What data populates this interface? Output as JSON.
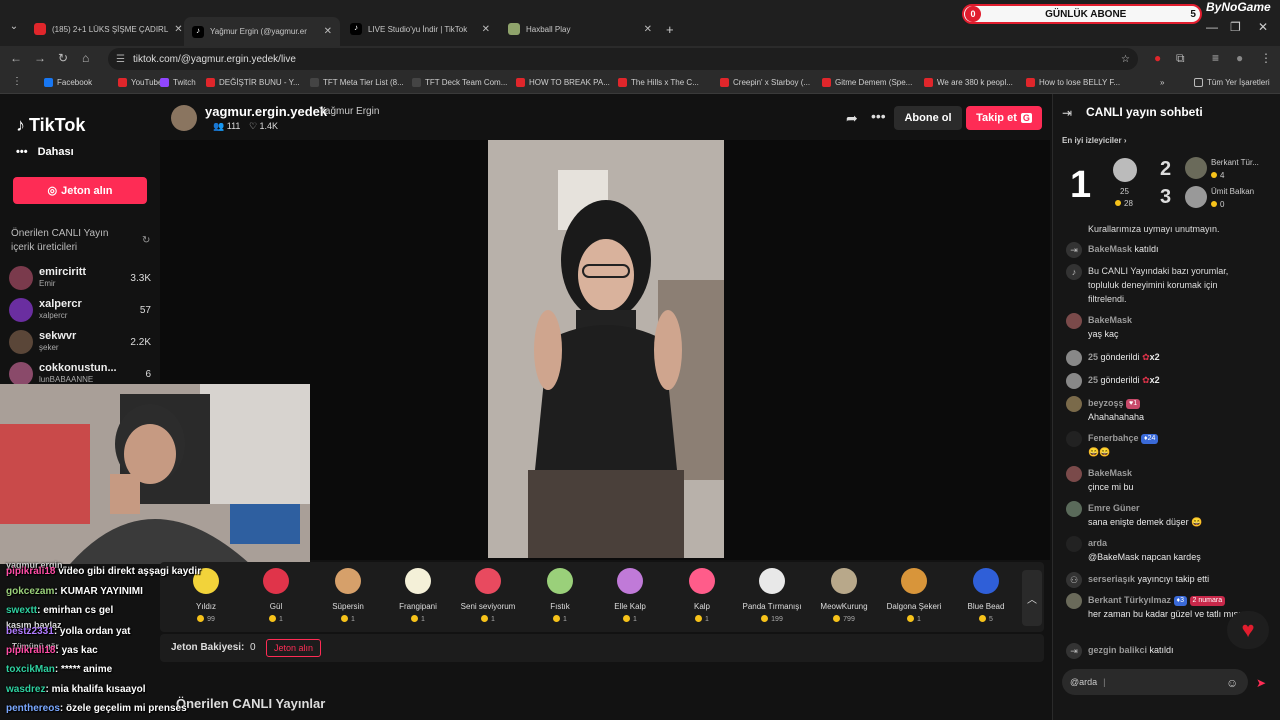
{
  "browser": {
    "tabs": [
      {
        "title": "(185) 2+1 LÜKS ŞİŞME ÇADIRL",
        "color": "#e0262b"
      },
      {
        "title": "Yağmur Ergin (@yagmur.er",
        "color": "#ffffff"
      },
      {
        "title": "LIVE Studio'yu İndir | TikTok",
        "color": "#ffffff"
      },
      {
        "title": "Haxball Play",
        "color": "#8fa36b"
      }
    ],
    "url": "tiktok.com/@yagmur.ergin.yedek/live",
    "bookmarks": [
      {
        "label": "Facebook",
        "color": "#1877f2"
      },
      {
        "label": "YouTube",
        "color": "#e0262b"
      },
      {
        "label": "Twitch",
        "color": "#9146ff"
      },
      {
        "label": "DEĞİŞTİR BUNU - Y...",
        "color": "#e0262b"
      },
      {
        "label": "TFT Meta Tier List (8...",
        "color": "#444444"
      },
      {
        "label": "TFT Deck Team Com...",
        "color": "#444444"
      },
      {
        "label": "HOW TO BREAK PA...",
        "color": "#e0262b"
      },
      {
        "label": "The Hills x The C...",
        "color": "#e0262b"
      },
      {
        "label": "Creepin' x Starboy (...",
        "color": "#e0262b"
      },
      {
        "label": "Gitme Demem (Spe...",
        "color": "#e0262b"
      },
      {
        "label": "We are 380 k peopl...",
        "color": "#e0262b"
      },
      {
        "label": "How to lose BELLY F...",
        "color": "#e0262b"
      }
    ],
    "all_bookmarks": "Tüm Yer İşaretleri"
  },
  "overlay": {
    "left": "0",
    "label": "GÜNLÜK ABONE",
    "right": "5",
    "brand": "ByNoGame"
  },
  "sidebar": {
    "logo": "TikTok",
    "more": "Dahası",
    "coin_button": "Jeton alın",
    "suggested_header": "Önerilen CANLI Yayın içerik üreticileri",
    "creators": [
      {
        "name": "emirciritt",
        "sub": "Emir",
        "count": "3.3K"
      },
      {
        "name": "xalpercr",
        "sub": "xalpercr",
        "count": "57"
      },
      {
        "name": "sekwvr",
        "sub": "şeker",
        "count": "2.2K"
      },
      {
        "name": "cokkonustun...",
        "sub": "lunBABAANNE",
        "count": "6"
      }
    ]
  },
  "stream": {
    "username": "yagmur.ergin.yedek",
    "display_name": "Yağmur Ergin",
    "viewers": "111",
    "likes": "1.4K",
    "subscribe": "Abone ol",
    "follow": "Takip et",
    "follow_badge": "G"
  },
  "gifts": [
    {
      "name": "Yıldız",
      "price": "99",
      "color": "#f2d33a"
    },
    {
      "name": "Gül",
      "price": "1",
      "color": "#e0344a"
    },
    {
      "name": "Süpersin",
      "price": "1",
      "color": "#d6a06a"
    },
    {
      "name": "Frangipani",
      "price": "1",
      "color": "#f4f0d8"
    },
    {
      "name": "Seni seviyorum",
      "price": "1",
      "color": "#e84a5f"
    },
    {
      "name": "Fıstık",
      "price": "1",
      "color": "#9ad07a"
    },
    {
      "name": "Elle Kalp",
      "price": "1",
      "color": "#c07ad8"
    },
    {
      "name": "Kalp",
      "price": "1",
      "color": "#ff5c8a"
    },
    {
      "name": "Panda Tırmanışı",
      "price": "199",
      "color": "#e8e8e8"
    },
    {
      "name": "MeowKurung",
      "price": "799",
      "color": "#b8a88a"
    },
    {
      "name": "Dalgona Şekeri",
      "price": "1",
      "color": "#d8953a"
    },
    {
      "name": "Blue Bead",
      "price": "5",
      "color": "#2f5fd8"
    }
  ],
  "balance": {
    "label": "Jeton Bakiyesi:",
    "value": "0",
    "button": "Jeton alın"
  },
  "recommended_header": "Önerilen CANLI Yayınlar",
  "twitch_chat": [
    {
      "user": "yagmur.ergin...",
      "text": "",
      "color": "#cccccc"
    },
    {
      "user": "pipikrali18",
      "text": "video gibi direkt aşşagi kaydir",
      "color": "#ff4da6"
    },
    {
      "user": "gokcezam",
      "text": ": KUMAR YAYINIMI",
      "color": "#9ad07a"
    },
    {
      "user": "swextt",
      "text": ": emirhan cs gel",
      "color": "#2fd0a0"
    },
    {
      "user": "kasım baylaz",
      "text": "",
      "color": "#cccccc"
    },
    {
      "user": "bestz2331",
      "text": ": yolla ordan yat",
      "color": "#b07aff"
    },
    {
      "user": "Tümünü gör",
      "text": "",
      "color": "#cccccc"
    },
    {
      "user": "pipikrali18",
      "text": ": yas kac",
      "color": "#ff4da6"
    },
    {
      "user": "toxcikMan",
      "text": ": ***** anime",
      "color": "#2fd0a0"
    },
    {
      "user": "wasdrez",
      "text": ": mia khalifa kısaayol",
      "color": "#2fd0a0"
    },
    {
      "user": "penthereos",
      "text": ": özele geçelim mi prenses",
      "color": "#7aa8ff"
    }
  ],
  "chat": {
    "title": "CANLI yayın sohbeti",
    "top_viewers_label": "En iyi izleyiciler",
    "top": [
      {
        "rank": "1",
        "sub": "25",
        "coins": "28"
      },
      {
        "rank": "2",
        "name": "Berkant Tür...",
        "coins": "4"
      },
      {
        "rank": "3",
        "name": "Ümit Balkan",
        "coins": "0"
      }
    ],
    "messages": [
      {
        "type": "text",
        "user": "",
        "text": "Kurallarımıza uymayı unutmayın."
      },
      {
        "type": "join",
        "user": "BakeMask",
        "text": "katıldı"
      },
      {
        "type": "sys",
        "user": "",
        "text": "Bu CANLI Yayındaki bazı yorumlar, topluluk deneyimini korumak için filtrelendi."
      },
      {
        "type": "msg",
        "user": "BakeMask",
        "text": "yaş kaç"
      },
      {
        "type": "gift",
        "user": "25",
        "text": "gönderildi",
        "qty": "x2"
      },
      {
        "type": "gift",
        "user": "25",
        "text": "gönderildi",
        "qty": "x2"
      },
      {
        "type": "msg",
        "user": "beyzoşş",
        "badge": "1",
        "text": "Ahahahahaha"
      },
      {
        "type": "msg",
        "user": "Fenerbahçe",
        "badge": "24",
        "text": "😄😄"
      },
      {
        "type": "msg",
        "user": "BakeMask",
        "text": "çince mi bu"
      },
      {
        "type": "msg",
        "user": "Emre Güner",
        "text": "sana enişte demek düşer 😄"
      },
      {
        "type": "msg",
        "user": "arda",
        "text": "@BakeMask napcan kardeş"
      },
      {
        "type": "follow",
        "user": "serseriaşık",
        "text": "yayıncıyı takip etti"
      },
      {
        "type": "msg",
        "user": "Berkant Türkyılmaz",
        "badge": "3",
        "badge2": "2 numara",
        "text": "her zaman bu kadar güzel ve tatlı mısın"
      },
      {
        "type": "join",
        "user": "gezgin balikci",
        "text": "katıldı"
      }
    ],
    "input_value": "@arda"
  }
}
